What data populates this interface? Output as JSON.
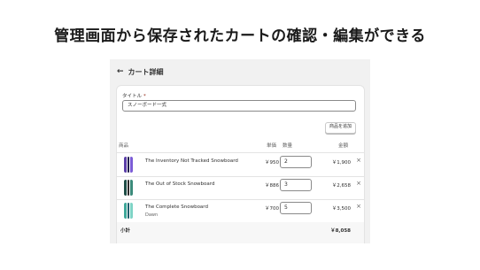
{
  "headline": "管理画面から保存されたカートの確認・編集ができる",
  "page": {
    "back_icon": "←",
    "title": "カート詳細"
  },
  "form": {
    "title_label": "タイトル",
    "required_mark": "*",
    "title_value": "スノーボード一式",
    "add_button": "商品を追加"
  },
  "table": {
    "headers": {
      "product": "商品",
      "unit_price": "単価",
      "quantity": "数量",
      "amount": "金額"
    },
    "rows": [
      {
        "name": "The Inventory Not Tracked Snowboard",
        "variant": "",
        "price": "￥950",
        "qty": "2",
        "amount": "￥1,900",
        "remove_icon": "×",
        "colors": [
          "#5b3fa8",
          "#1f1a4d",
          "#7b5cd6"
        ]
      },
      {
        "name": "The Out of Stock Snowboard",
        "variant": "",
        "price": "￥886",
        "qty": "3",
        "amount": "￥2,658",
        "remove_icon": "×",
        "colors": [
          "#1f4e47",
          "#2a2a2a",
          "#3b8a7a"
        ]
      },
      {
        "name": "The Complete Snowboard",
        "variant": "Dawn",
        "price": "￥700",
        "qty": "5",
        "amount": "￥3,500",
        "remove_icon": "×",
        "colors": [
          "#3fa89a",
          "#1d5d6b",
          "#7fd4c6"
        ]
      }
    ]
  },
  "subtotal": {
    "label": "小計",
    "value": "￥8,058"
  }
}
